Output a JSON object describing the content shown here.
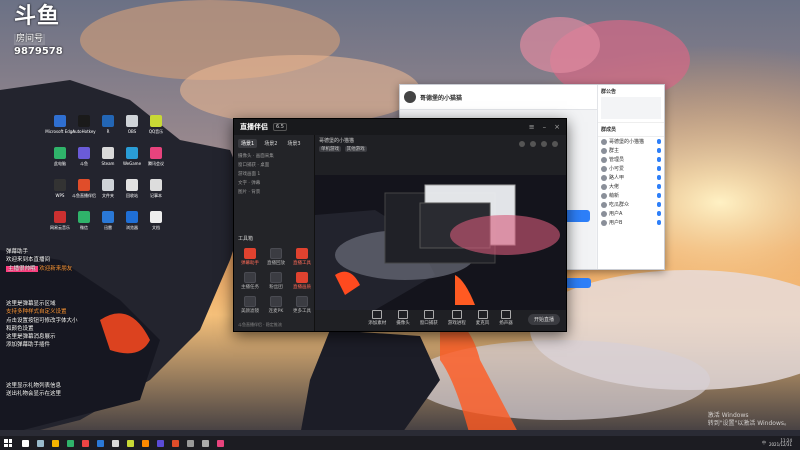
{
  "watermark": {
    "logo": "斗鱼",
    "room_label": "房间号",
    "room_number": "9879578"
  },
  "desktop_icons": [
    {
      "label": "Microsoft Edge",
      "color": "#2f6fd1"
    },
    {
      "label": "AutoHotkey",
      "color": "#1a1a1a"
    },
    {
      "label": "R",
      "color": "#2366b5"
    },
    {
      "label": "OBS",
      "color": "#cfd3d8"
    },
    {
      "label": "QQ音乐",
      "color": "#c8d935"
    },
    {
      "label": "此电脑",
      "color": "#2fb36a"
    },
    {
      "label": "斗鱼",
      "color": "#6a5bd8"
    },
    {
      "label": "Steam",
      "color": "#d9d9d9"
    },
    {
      "label": "WeGame",
      "color": "#2a9dd6"
    },
    {
      "label": "腾讯会议",
      "color": "#e8437d"
    },
    {
      "label": "WPS",
      "color": "#333"
    },
    {
      "label": "斗鱼直播伴侣",
      "color": "#e04d2a"
    },
    {
      "label": "文件夹",
      "color": "#cfd3d8"
    },
    {
      "label": "回收站",
      "color": "#e2e2e2"
    },
    {
      "label": "记事本",
      "color": "#ddd"
    },
    {
      "label": "网易云音乐",
      "color": "#cc3030"
    },
    {
      "label": "微信",
      "color": "#2fb36a"
    },
    {
      "label": "迅雷",
      "color": "#2a78d6"
    },
    {
      "label": "浏览器",
      "color": "#1f6fd6"
    },
    {
      "label": "文档",
      "color": "#eee"
    }
  ],
  "chat_overlay": {
    "line1": "弹幕助手",
    "line2": "欢迎来到本直播间",
    "hl_tag": "主播很帅哦",
    "line3": "欢迎新来朋友",
    "block2": [
      "这里是弹幕显示区域",
      "支持多种样式自定义设置",
      "点击设置按钮可修改字体大小",
      "和颜色设置",
      "这里是弹幕消息展示",
      "添加弹幕助手插件"
    ],
    "block3": [
      "这里显示礼物列表信息",
      "送出礼物会显示在这里"
    ]
  },
  "qq_window": {
    "title": "哥德堡的小猫猫",
    "members_title": "群成员",
    "notice": "群公告",
    "members": [
      "哥德堡的小猫猫",
      "群主",
      "管理员",
      "小可爱",
      "路人甲",
      "大佬",
      "萌新",
      "吃瓜群众",
      "用户A",
      "用户B"
    ]
  },
  "app": {
    "brand": "直播伴侣",
    "version": "6.5",
    "tabs": [
      "场景1",
      "场景2",
      "场景3"
    ],
    "scenes": [
      "摄像头 · 画面采集",
      "窗口捕获 · 桌面",
      "游戏画面 1",
      "文字 · 弹幕",
      "图片 · 背景"
    ],
    "toolbox_title": "工具箱",
    "tools": [
      {
        "label": "弹幕助手",
        "red": true
      },
      {
        "label": "直播回放",
        "red": false
      },
      {
        "label": "直播工具",
        "red": true
      },
      {
        "label": "主播任务",
        "red": false
      },
      {
        "label": "粉丝团",
        "red": false
      },
      {
        "label": "直播画质",
        "red": true
      },
      {
        "label": "美颜滤镜",
        "red": false
      },
      {
        "label": "连麦PK",
        "red": false
      },
      {
        "label": "更多工具",
        "red": false
      },
      {
        "label": "设置",
        "red": false
      }
    ],
    "footer": "斗鱼直播伴侣 · 稳定推流",
    "stream_title": "哥德堡的小猫猫",
    "stream_cats": [
      "单机游戏",
      "其他游戏"
    ],
    "bottom_actions": [
      "添加素材",
      "摄像头",
      "窗口捕获",
      "游戏进程",
      "麦克风",
      "扬声器"
    ],
    "start_live": "开始直播"
  },
  "windows_activate": {
    "line1": "激活 Windows",
    "line2": "转到\"设置\"以激活 Windows。"
  },
  "taskbar": {
    "icon_colors": [
      "#ffffff",
      "#9bc",
      "#f5b300",
      "#2fb36a",
      "#e44",
      "#2a78d6",
      "#d9d9d9",
      "#c8d935",
      "#ff8a00",
      "#5a4bd8",
      "#e04d2a",
      "#999",
      "#aaa",
      "#e8437d"
    ],
    "time": "11:24",
    "date": "2021/12/31",
    "lang": "中"
  }
}
